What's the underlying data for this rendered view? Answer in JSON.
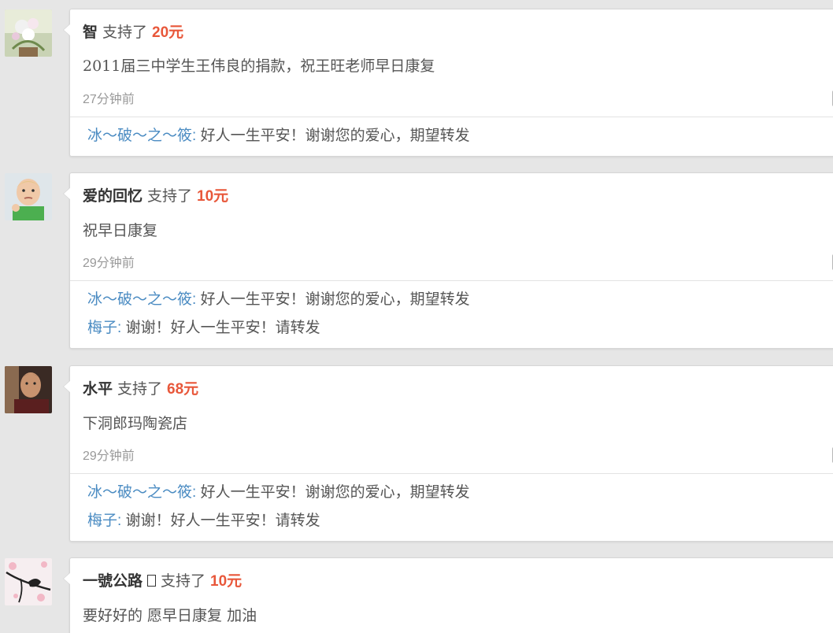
{
  "entries": [
    {
      "user": "智",
      "supported": "支持了",
      "amount": "20",
      "unit": "元",
      "message": "2011届三中学生王伟良的捐款，祝王旺老师早日康复",
      "time_num": "27",
      "time_word": "分钟前",
      "replies": [
        {
          "name": "冰～破～之～筱",
          "sep": ": ",
          "text": "好人一生平安！谢谢您的爱心，期望转发"
        }
      ]
    },
    {
      "user": "爱的回忆",
      "supported": "支持了",
      "amount": "10",
      "unit": "元",
      "message": "祝早日康复",
      "time_num": "29",
      "time_word": "分钟前",
      "replies": [
        {
          "name": "冰～破～之～筱",
          "sep": ": ",
          "text": "好人一生平安！谢谢您的爱心，期望转发"
        },
        {
          "name": "梅子",
          "sep": ": ",
          "text": "谢谢！好人一生平安！请转发"
        }
      ]
    },
    {
      "user": "水平",
      "supported": "支持了",
      "amount": "68",
      "unit": "元",
      "message": "下洞郎玛陶瓷店",
      "time_num": "29",
      "time_word": "分钟前",
      "replies": [
        {
          "name": "冰～破～之～筱",
          "sep": ": ",
          "text": "好人一生平安！谢谢您的爱心，期望转发"
        },
        {
          "name": "梅子",
          "sep": ": ",
          "text": "谢谢！好人一生平安！请转发"
        }
      ]
    },
    {
      "user": "一號公路",
      "supported": "支持了",
      "amount": "10",
      "unit": "元",
      "message": "要好好的 愿早日康复 加油"
    }
  ],
  "colors": {
    "background": "#e6e6e6",
    "amount": "#e8573a",
    "reply_name": "#4a8bc2",
    "text": "#555555",
    "time": "#999999"
  }
}
